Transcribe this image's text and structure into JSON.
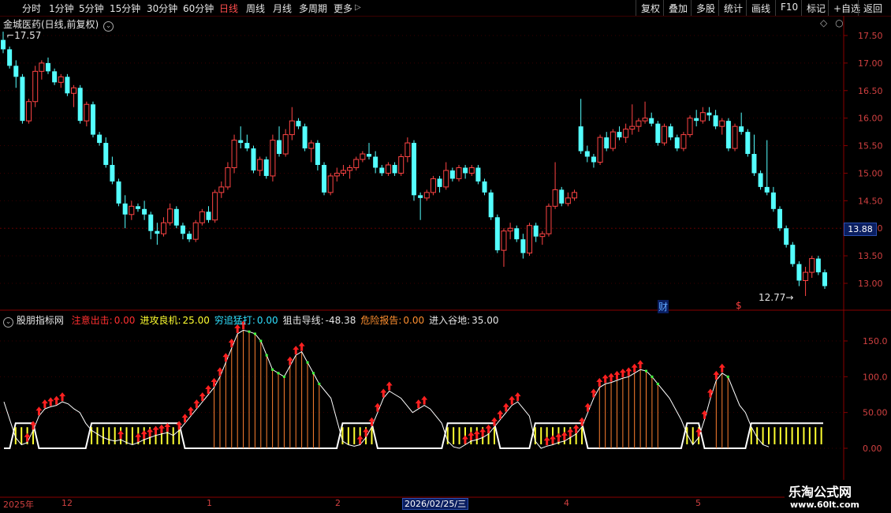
{
  "toolbar": {
    "periods": [
      "分时",
      "1分钟",
      "5分钟",
      "15分钟",
      "30分钟",
      "60分钟",
      "日线",
      "周线",
      "月线",
      "多周期",
      "更多"
    ],
    "active": "日线",
    "right_buttons": [
      "复权",
      "叠加",
      "多股",
      "统计",
      "画线",
      "F10",
      "标记",
      "+自选",
      "返回"
    ]
  },
  "main_panel": {
    "title": "金城医药(日线,前复权)",
    "high_label": "17.57",
    "low_label": "12.77",
    "current_price": "13.88",
    "marker_cai": "财",
    "marker_s": "$",
    "y_ticks": [
      "17.50",
      "17.00",
      "16.50",
      "16.00",
      "15.50",
      "15.00",
      "14.50",
      "14.00",
      "13.50",
      "13.00"
    ]
  },
  "indicator_panel": {
    "name": "股朋指标网",
    "items": [
      {
        "label": "注意出击:",
        "value": "0.00",
        "color": "#ff3030"
      },
      {
        "label": "进攻良机:",
        "value": "25.00",
        "color": "#ffff30"
      },
      {
        "label": "穷追猛打:",
        "value": "0.00",
        "color": "#30e0ff"
      },
      {
        "label": "狙击导线:",
        "value": "-48.38",
        "color": "#e6e6e6"
      },
      {
        "label": "危险报告:",
        "value": "0.00",
        "color": "#ff9030"
      },
      {
        "label": "进入谷地:",
        "value": "35.00",
        "color": "#e6e6e6"
      }
    ],
    "y_ticks": [
      "150.0",
      "100.0",
      "50.00",
      "0.00"
    ]
  },
  "xaxis": {
    "labels": [
      "2025年",
      "12",
      "1",
      "2",
      "4",
      "5"
    ],
    "cursor_date": "2026/02/25/三"
  },
  "watermark": {
    "main": "乐淘公式网",
    "url": "www.60lt.com"
  },
  "chart_data": {
    "type": "candlestick",
    "series": [
      {
        "o": 17.42,
        "h": 17.57,
        "l": 17.18,
        "c": 17.25
      },
      {
        "o": 17.25,
        "h": 17.3,
        "l": 16.9,
        "c": 16.95
      },
      {
        "o": 16.95,
        "h": 17.05,
        "l": 16.55,
        "c": 16.75
      },
      {
        "o": 16.75,
        "h": 16.8,
        "l": 15.9,
        "c": 15.95
      },
      {
        "o": 15.95,
        "h": 16.35,
        "l": 15.9,
        "c": 16.3
      },
      {
        "o": 16.3,
        "h": 16.95,
        "l": 16.2,
        "c": 16.85
      },
      {
        "o": 16.85,
        "h": 17.05,
        "l": 16.7,
        "c": 17.0
      },
      {
        "o": 17.0,
        "h": 17.1,
        "l": 16.8,
        "c": 16.85
      },
      {
        "o": 16.85,
        "h": 16.9,
        "l": 16.6,
        "c": 16.65
      },
      {
        "o": 16.65,
        "h": 16.8,
        "l": 16.55,
        "c": 16.75
      },
      {
        "o": 16.75,
        "h": 16.8,
        "l": 16.4,
        "c": 16.45
      },
      {
        "o": 16.45,
        "h": 16.6,
        "l": 16.2,
        "c": 16.55
      },
      {
        "o": 16.55,
        "h": 16.6,
        "l": 15.9,
        "c": 15.95
      },
      {
        "o": 15.95,
        "h": 16.3,
        "l": 15.85,
        "c": 16.25
      },
      {
        "o": 16.25,
        "h": 16.3,
        "l": 15.65,
        "c": 15.7
      },
      {
        "o": 15.7,
        "h": 15.75,
        "l": 15.5,
        "c": 15.55
      },
      {
        "o": 15.55,
        "h": 15.65,
        "l": 15.1,
        "c": 15.15
      },
      {
        "o": 15.15,
        "h": 15.3,
        "l": 14.8,
        "c": 14.85
      },
      {
        "o": 14.85,
        "h": 14.9,
        "l": 14.4,
        "c": 14.45
      },
      {
        "o": 14.45,
        "h": 14.6,
        "l": 14.0,
        "c": 14.25
      },
      {
        "o": 14.25,
        "h": 14.5,
        "l": 14.15,
        "c": 14.4
      },
      {
        "o": 14.4,
        "h": 14.45,
        "l": 14.3,
        "c": 14.35
      },
      {
        "o": 14.35,
        "h": 14.5,
        "l": 14.15,
        "c": 14.25
      },
      {
        "o": 14.25,
        "h": 14.3,
        "l": 13.8,
        "c": 13.95
      },
      {
        "o": 13.95,
        "h": 14.1,
        "l": 13.7,
        "c": 13.9
      },
      {
        "o": 13.9,
        "h": 14.2,
        "l": 13.85,
        "c": 14.1
      },
      {
        "o": 14.1,
        "h": 14.45,
        "l": 14.05,
        "c": 14.35
      },
      {
        "o": 14.35,
        "h": 14.4,
        "l": 14.0,
        "c": 14.05
      },
      {
        "o": 14.05,
        "h": 14.1,
        "l": 13.8,
        "c": 13.9
      },
      {
        "o": 13.9,
        "h": 13.95,
        "l": 13.75,
        "c": 13.8
      },
      {
        "o": 13.8,
        "h": 14.15,
        "l": 13.75,
        "c": 14.1
      },
      {
        "o": 14.1,
        "h": 14.35,
        "l": 14.05,
        "c": 14.3
      },
      {
        "o": 14.3,
        "h": 14.4,
        "l": 14.1,
        "c": 14.15
      },
      {
        "o": 14.15,
        "h": 14.7,
        "l": 14.1,
        "c": 14.65
      },
      {
        "o": 14.65,
        "h": 14.85,
        "l": 14.55,
        "c": 14.75
      },
      {
        "o": 14.75,
        "h": 15.2,
        "l": 14.7,
        "c": 15.1
      },
      {
        "o": 15.1,
        "h": 15.7,
        "l": 15.0,
        "c": 15.6
      },
      {
        "o": 15.6,
        "h": 15.85,
        "l": 15.45,
        "c": 15.55
      },
      {
        "o": 15.55,
        "h": 15.7,
        "l": 15.4,
        "c": 15.45
      },
      {
        "o": 15.45,
        "h": 15.5,
        "l": 15.0,
        "c": 15.05
      },
      {
        "o": 15.05,
        "h": 15.3,
        "l": 14.95,
        "c": 15.25
      },
      {
        "o": 15.25,
        "h": 15.3,
        "l": 14.9,
        "c": 14.95
      },
      {
        "o": 14.95,
        "h": 15.7,
        "l": 14.85,
        "c": 15.6
      },
      {
        "o": 15.6,
        "h": 15.85,
        "l": 15.3,
        "c": 15.35
      },
      {
        "o": 15.35,
        "h": 15.8,
        "l": 15.3,
        "c": 15.7
      },
      {
        "o": 15.7,
        "h": 16.2,
        "l": 15.6,
        "c": 15.95
      },
      {
        "o": 15.95,
        "h": 16.0,
        "l": 15.8,
        "c": 15.85
      },
      {
        "o": 15.85,
        "h": 15.9,
        "l": 15.4,
        "c": 15.45
      },
      {
        "o": 15.45,
        "h": 15.6,
        "l": 15.2,
        "c": 15.55
      },
      {
        "o": 15.55,
        "h": 15.6,
        "l": 15.05,
        "c": 15.15
      },
      {
        "o": 15.15,
        "h": 15.2,
        "l": 14.6,
        "c": 14.65
      },
      {
        "o": 14.65,
        "h": 15.0,
        "l": 14.6,
        "c": 14.95
      },
      {
        "o": 14.95,
        "h": 15.1,
        "l": 14.85,
        "c": 15.0
      },
      {
        "o": 15.0,
        "h": 15.15,
        "l": 14.95,
        "c": 15.05
      },
      {
        "o": 15.05,
        "h": 15.15,
        "l": 14.9,
        "c": 15.1
      },
      {
        "o": 15.1,
        "h": 15.3,
        "l": 15.05,
        "c": 15.25
      },
      {
        "o": 15.25,
        "h": 15.4,
        "l": 15.2,
        "c": 15.35
      },
      {
        "o": 15.35,
        "h": 15.55,
        "l": 15.25,
        "c": 15.3
      },
      {
        "o": 15.3,
        "h": 15.4,
        "l": 15.0,
        "c": 15.1
      },
      {
        "o": 15.1,
        "h": 15.15,
        "l": 14.95,
        "c": 15.0
      },
      {
        "o": 15.0,
        "h": 15.2,
        "l": 14.95,
        "c": 15.15
      },
      {
        "o": 15.15,
        "h": 15.2,
        "l": 14.95,
        "c": 15.0
      },
      {
        "o": 15.0,
        "h": 15.35,
        "l": 14.95,
        "c": 15.3
      },
      {
        "o": 15.3,
        "h": 15.65,
        "l": 15.2,
        "c": 15.55
      },
      {
        "o": 15.55,
        "h": 15.6,
        "l": 14.5,
        "c": 14.6
      },
      {
        "o": 14.6,
        "h": 14.65,
        "l": 14.15,
        "c": 14.55
      },
      {
        "o": 14.55,
        "h": 14.7,
        "l": 14.5,
        "c": 14.65
      },
      {
        "o": 14.65,
        "h": 14.95,
        "l": 14.6,
        "c": 14.9
      },
      {
        "o": 14.9,
        "h": 14.95,
        "l": 14.65,
        "c": 14.75
      },
      {
        "o": 14.75,
        "h": 15.2,
        "l": 14.7,
        "c": 15.05
      },
      {
        "o": 15.05,
        "h": 15.1,
        "l": 14.85,
        "c": 14.9
      },
      {
        "o": 14.9,
        "h": 15.15,
        "l": 14.85,
        "c": 15.1
      },
      {
        "o": 15.1,
        "h": 15.15,
        "l": 14.9,
        "c": 15.0
      },
      {
        "o": 15.0,
        "h": 15.15,
        "l": 14.95,
        "c": 15.1
      },
      {
        "o": 15.1,
        "h": 15.15,
        "l": 14.8,
        "c": 14.85
      },
      {
        "o": 14.85,
        "h": 14.9,
        "l": 14.6,
        "c": 14.65
      },
      {
        "o": 14.65,
        "h": 14.7,
        "l": 14.15,
        "c": 14.2
      },
      {
        "o": 14.2,
        "h": 14.25,
        "l": 13.55,
        "c": 13.6
      },
      {
        "o": 13.6,
        "h": 14.0,
        "l": 13.3,
        "c": 13.95
      },
      {
        "o": 13.95,
        "h": 14.1,
        "l": 13.8,
        "c": 14.0
      },
      {
        "o": 14.0,
        "h": 14.05,
        "l": 13.75,
        "c": 13.8
      },
      {
        "o": 13.8,
        "h": 13.9,
        "l": 13.45,
        "c": 13.55
      },
      {
        "o": 13.55,
        "h": 14.1,
        "l": 13.5,
        "c": 14.05
      },
      {
        "o": 14.05,
        "h": 14.1,
        "l": 13.75,
        "c": 13.85
      },
      {
        "o": 13.85,
        "h": 13.95,
        "l": 13.7,
        "c": 13.9
      },
      {
        "o": 13.9,
        "h": 14.45,
        "l": 13.85,
        "c": 14.4
      },
      {
        "o": 14.4,
        "h": 15.2,
        "l": 14.35,
        "c": 14.7
      },
      {
        "o": 14.7,
        "h": 14.75,
        "l": 14.4,
        "c": 14.45
      },
      {
        "o": 14.45,
        "h": 14.65,
        "l": 14.4,
        "c": 14.55
      },
      {
        "o": 14.55,
        "h": 14.7,
        "l": 14.5,
        "c": 14.65
      },
      {
        "o": 15.85,
        "h": 16.35,
        "l": 15.35,
        "c": 15.4
      },
      {
        "o": 15.4,
        "h": 15.5,
        "l": 15.2,
        "c": 15.3
      },
      {
        "o": 15.3,
        "h": 15.35,
        "l": 15.1,
        "c": 15.2
      },
      {
        "o": 15.2,
        "h": 15.7,
        "l": 15.15,
        "c": 15.65
      },
      {
        "o": 15.65,
        "h": 15.75,
        "l": 15.4,
        "c": 15.45
      },
      {
        "o": 15.45,
        "h": 15.8,
        "l": 15.4,
        "c": 15.75
      },
      {
        "o": 15.75,
        "h": 15.85,
        "l": 15.6,
        "c": 15.65
      },
      {
        "o": 15.65,
        "h": 15.9,
        "l": 15.55,
        "c": 15.8
      },
      {
        "o": 15.8,
        "h": 16.25,
        "l": 15.7,
        "c": 15.85
      },
      {
        "o": 15.85,
        "h": 16.0,
        "l": 15.75,
        "c": 15.95
      },
      {
        "o": 15.95,
        "h": 16.3,
        "l": 15.9,
        "c": 16.0
      },
      {
        "o": 16.0,
        "h": 16.1,
        "l": 15.85,
        "c": 15.9
      },
      {
        "o": 15.9,
        "h": 15.95,
        "l": 15.5,
        "c": 15.55
      },
      {
        "o": 15.55,
        "h": 15.9,
        "l": 15.5,
        "c": 15.85
      },
      {
        "o": 15.85,
        "h": 15.9,
        "l": 15.6,
        "c": 15.65
      },
      {
        "o": 15.65,
        "h": 15.7,
        "l": 15.4,
        "c": 15.45
      },
      {
        "o": 15.45,
        "h": 15.75,
        "l": 15.4,
        "c": 15.7
      },
      {
        "o": 15.7,
        "h": 16.05,
        "l": 15.65,
        "c": 16.0
      },
      {
        "o": 16.0,
        "h": 16.15,
        "l": 15.85,
        "c": 15.95
      },
      {
        "o": 15.95,
        "h": 16.2,
        "l": 15.9,
        "c": 16.1
      },
      {
        "o": 16.1,
        "h": 16.2,
        "l": 15.95,
        "c": 16.05
      },
      {
        "o": 16.05,
        "h": 16.15,
        "l": 15.8,
        "c": 15.85
      },
      {
        "o": 15.85,
        "h": 16.0,
        "l": 15.7,
        "c": 15.95
      },
      {
        "o": 15.95,
        "h": 16.0,
        "l": 15.4,
        "c": 15.45
      },
      {
        "o": 15.45,
        "h": 15.9,
        "l": 15.4,
        "c": 15.85
      },
      {
        "o": 15.85,
        "h": 16.1,
        "l": 15.7,
        "c": 15.75
      },
      {
        "o": 15.75,
        "h": 15.8,
        "l": 15.3,
        "c": 15.35
      },
      {
        "o": 15.35,
        "h": 15.7,
        "l": 14.95,
        "c": 15.0
      },
      {
        "o": 15.0,
        "h": 15.05,
        "l": 14.7,
        "c": 14.75
      },
      {
        "o": 14.75,
        "h": 15.6,
        "l": 14.6,
        "c": 14.65
      },
      {
        "o": 14.65,
        "h": 14.75,
        "l": 14.3,
        "c": 14.35
      },
      {
        "o": 14.35,
        "h": 14.4,
        "l": 13.95,
        "c": 14.0
      },
      {
        "o": 14.0,
        "h": 14.05,
        "l": 13.65,
        "c": 13.7
      },
      {
        "o": 13.7,
        "h": 13.75,
        "l": 13.3,
        "c": 13.35
      },
      {
        "o": 13.35,
        "h": 13.4,
        "l": 12.95,
        "c": 13.05
      },
      {
        "o": 13.05,
        "h": 13.3,
        "l": 12.77,
        "c": 13.2
      },
      {
        "o": 13.2,
        "h": 13.5,
        "l": 13.1,
        "c": 13.45
      },
      {
        "o": 13.45,
        "h": 13.5,
        "l": 13.15,
        "c": 13.2
      },
      {
        "o": 13.2,
        "h": 13.25,
        "l": 12.9,
        "c": 12.95
      }
    ],
    "indicator_line": [
      65,
      40,
      15,
      5,
      8,
      25,
      45,
      55,
      58,
      60,
      65,
      62,
      55,
      50,
      35,
      25,
      20,
      15,
      12,
      10,
      12,
      8,
      5,
      8,
      12,
      15,
      18,
      20,
      22,
      18,
      25,
      35,
      45,
      55,
      65,
      75,
      85,
      100,
      120,
      140,
      160,
      165,
      163,
      160,
      150,
      130,
      110,
      105,
      100,
      115,
      130,
      135,
      120,
      105,
      90,
      80,
      70,
      40,
      10,
      5,
      3,
      5,
      15,
      30,
      50,
      70,
      80,
      75,
      70,
      60,
      50,
      55,
      60,
      55,
      45,
      35,
      10,
      2,
      0,
      5,
      10,
      12,
      15,
      20,
      30,
      40,
      50,
      60,
      65,
      55,
      45,
      10,
      0,
      3,
      5,
      8,
      10,
      15,
      20,
      30,
      50,
      70,
      85,
      90,
      92,
      95,
      98,
      100,
      105,
      110,
      108,
      100,
      90,
      80,
      70,
      55,
      40,
      20,
      5,
      15,
      40,
      70,
      95,
      105,
      100,
      80,
      60,
      50,
      30,
      15,
      5,
      2
    ]
  }
}
